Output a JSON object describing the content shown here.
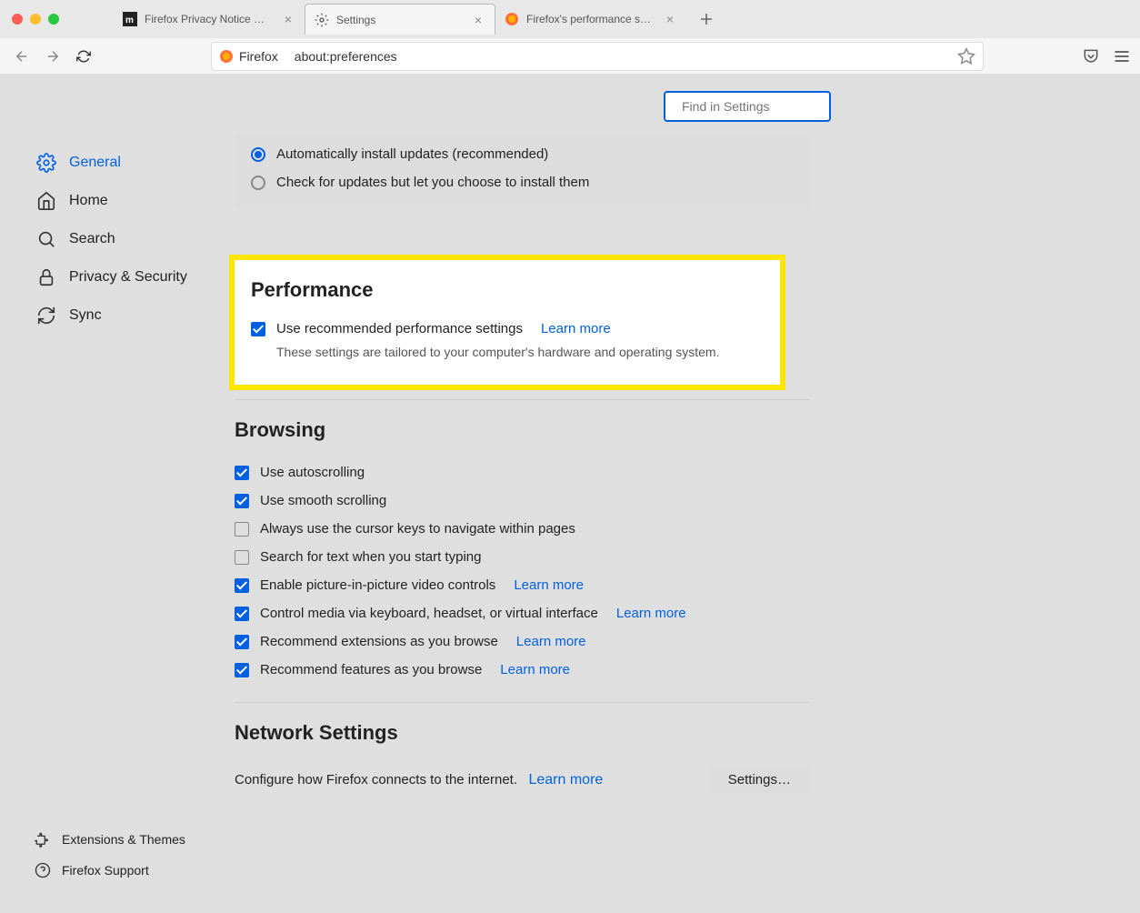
{
  "tabs": [
    {
      "title": "Firefox Privacy Notice — Mozilla"
    },
    {
      "title": "Settings"
    },
    {
      "title": "Firefox's performance settings"
    }
  ],
  "urlbar": {
    "brand": "Firefox",
    "url": "about:preferences"
  },
  "search": {
    "placeholder": "Find in Settings"
  },
  "sidebar": {
    "items": [
      {
        "label": "General"
      },
      {
        "label": "Home"
      },
      {
        "label": "Search"
      },
      {
        "label": "Privacy & Security"
      },
      {
        "label": "Sync"
      }
    ],
    "bottom": [
      {
        "label": "Extensions & Themes"
      },
      {
        "label": "Firefox Support"
      }
    ]
  },
  "updates": {
    "opt1": "Automatically install updates (recommended)",
    "opt2": "Check for updates but let you choose to install them"
  },
  "performance": {
    "title": "Performance",
    "opt1": "Use recommended performance settings",
    "learn": "Learn more",
    "desc": "These settings are tailored to your computer's hardware and operating system."
  },
  "browsing": {
    "title": "Browsing",
    "opt1": "Use autoscrolling",
    "opt2": "Use smooth scrolling",
    "opt3": "Always use the cursor keys to navigate within pages",
    "opt4": "Search for text when you start typing",
    "opt5": "Enable picture-in-picture video controls",
    "opt6": "Control media via keyboard, headset, or virtual interface",
    "opt7": "Recommend extensions as you browse",
    "opt8": "Recommend features as you browse",
    "learn": "Learn more"
  },
  "network": {
    "title": "Network Settings",
    "desc": "Configure how Firefox connects to the internet.",
    "learn": "Learn more",
    "button": "Settings…"
  }
}
